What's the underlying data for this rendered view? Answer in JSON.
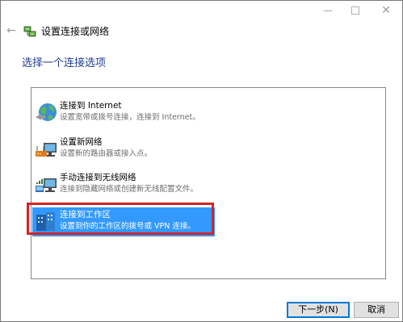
{
  "window": {
    "title": "设置连接或网络"
  },
  "page": {
    "instruction": "选择一个连接选项"
  },
  "options": [
    {
      "title": "连接到 Internet",
      "desc": "设置宽带或拨号连接，连接到 Internet。",
      "icon": "globe-network-icon"
    },
    {
      "title": "设置新网络",
      "desc": "设置新的路由器或接入点。",
      "icon": "router-setup-icon"
    },
    {
      "title": "手动连接到无线网络",
      "desc": "连接到隐藏网络或创建新无线配置文件。",
      "icon": "wireless-computer-icon"
    },
    {
      "title": "连接到工作区",
      "desc": "设置到你的工作区的拨号或 VPN 连接。",
      "icon": "workplace-icon",
      "selected": true
    }
  ],
  "buttons": {
    "next": "下一步(N)",
    "cancel": "取消"
  },
  "colors": {
    "selection": "#3399ff",
    "instruction": "#1e3d8f",
    "highlight_border": "#d62323"
  }
}
